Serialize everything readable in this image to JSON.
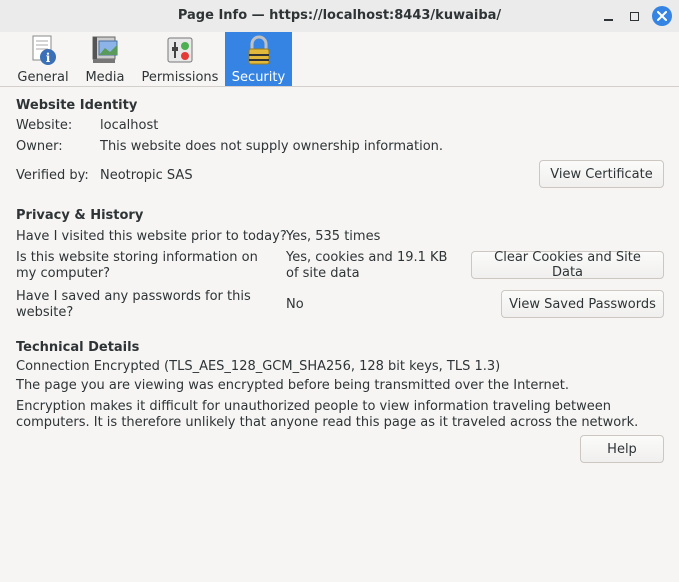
{
  "window": {
    "title": "Page Info — https://localhost:8443/kuwaiba/"
  },
  "tabs": [
    {
      "label": "General",
      "icon": "info-icon"
    },
    {
      "label": "Media",
      "icon": "media-icon"
    },
    {
      "label": "Permissions",
      "icon": "permissions-icon"
    },
    {
      "label": "Security",
      "icon": "lock-icon",
      "active": true
    }
  ],
  "identity": {
    "heading": "Website Identity",
    "website_label": "Website:",
    "website_value": "localhost",
    "owner_label": "Owner:",
    "owner_value": "This website does not supply ownership information.",
    "verified_label": "Verified by:",
    "verified_value": "Neotropic SAS",
    "view_certificate_button": "View Certificate"
  },
  "privacy": {
    "heading": "Privacy & History",
    "visited_question": "Have I visited this website prior to today?",
    "visited_answer": "Yes, 535 times",
    "storing_question": "Is this website storing information on my computer?",
    "storing_answer": "Yes, cookies and 19.1 KB of site data",
    "clear_button": "Clear Cookies and Site Data",
    "passwords_question": "Have I saved any passwords for this website?",
    "passwords_answer": "No",
    "view_passwords_button": "View Saved Passwords"
  },
  "technical": {
    "heading": "Technical Details",
    "connection": "Connection Encrypted (TLS_AES_128_GCM_SHA256, 128 bit keys, TLS 1.3)",
    "line1": "The page you are viewing was encrypted before being transmitted over the Internet.",
    "line2": "Encryption makes it difficult for unauthorized people to view information traveling between computers. It is therefore unlikely that anyone read this page as it traveled across the network."
  },
  "help_button": "Help",
  "colors": {
    "accent": "#3584e4"
  }
}
